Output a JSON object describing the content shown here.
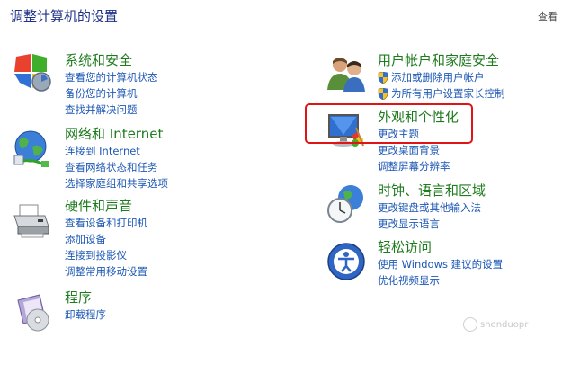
{
  "page_title": "调整计算机的设置",
  "view_by": "查看",
  "colors": {
    "category_title": "#1e7b1e",
    "link": "#1e58b4",
    "highlight": "#e01414"
  },
  "categories": {
    "system_security": {
      "icon": "shield-icon",
      "title": "系统和安全",
      "links": [
        "查看您的计算机状态",
        "备份您的计算机",
        "查找并解决问题"
      ]
    },
    "network_internet": {
      "icon": "network-globe-icon",
      "title": "网络和 Internet",
      "links": [
        "连接到 Internet",
        "查看网络状态和任务",
        "选择家庭组和共享选项"
      ]
    },
    "hardware_sound": {
      "icon": "printer-icon",
      "title": "硬件和声音",
      "links": [
        "查看设备和打印机",
        "添加设备",
        "连接到投影仪",
        "调整常用移动设置"
      ]
    },
    "programs": {
      "icon": "programs-disc-icon",
      "title": "程序",
      "links": [
        "卸载程序"
      ]
    },
    "user_accounts": {
      "icon": "users-icon",
      "title": "用户帐户和家庭安全",
      "links": [
        "添加或删除用户帐户",
        "为所有用户设置家长控制"
      ]
    },
    "appearance": {
      "icon": "monitor-palette-icon",
      "title": "外观和个性化",
      "links": [
        "更改主题",
        "更改桌面背景",
        "调整屏幕分辨率"
      ]
    },
    "clock_language": {
      "icon": "clock-globe-icon",
      "title": "时钟、语言和区域",
      "links": [
        "更改键盘或其他输入法",
        "更改显示语言"
      ]
    },
    "ease_of_access": {
      "icon": "accessibility-icon",
      "title": "轻松访问",
      "links": [
        "使用 Windows 建议的设置",
        "优化视频显示"
      ]
    }
  },
  "watermark": "shenduopr"
}
